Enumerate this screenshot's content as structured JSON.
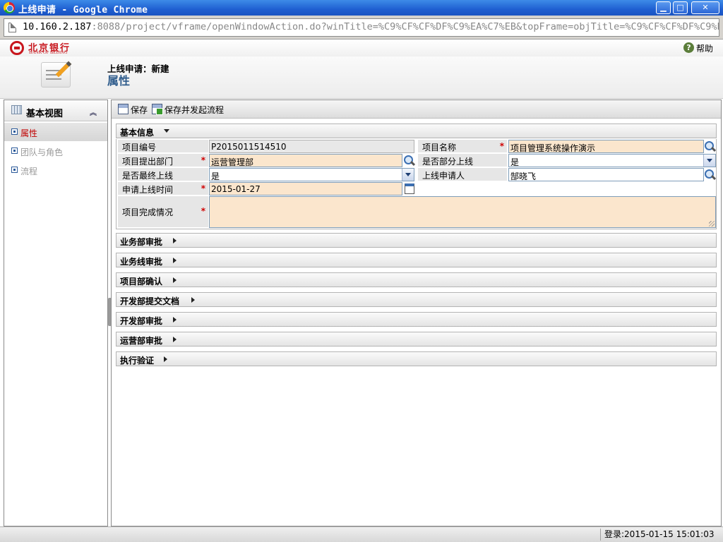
{
  "window": {
    "title": "上线申请 - Google Chrome",
    "minimize": "▁",
    "maximize": "□",
    "close": "✕"
  },
  "address_bar": {
    "host": "10.160.2.187",
    "rest": ":8088/project/vframe/openWindowAction.do?winTitle=%C9%CF%CF%DF%C9%EA%C7%EB&topFrame=objTitle=%C9%CF%CF%DF%C9%EA%C7"
  },
  "brand": {
    "name_cn": "北京银行",
    "name_en": "BANK OF BEIJING",
    "color": "#c8161d"
  },
  "help": {
    "icon": "?",
    "label": "帮助"
  },
  "header": {
    "subtitle": "上线申请：新建",
    "title": "属性"
  },
  "sidebar": {
    "title": "基本视图",
    "collapse": "︽",
    "items": [
      {
        "label": "属性",
        "state": "active"
      },
      {
        "label": "团队与角色",
        "state": "disabled"
      },
      {
        "label": "流程",
        "state": "disabled"
      }
    ]
  },
  "toolbar": {
    "save": "保存",
    "save_and_start": "保存并发起流程"
  },
  "basic_info": {
    "title": "基本信息",
    "fields": {
      "project_code": {
        "label": "项目编号",
        "value": "P2015011514510"
      },
      "project_name": {
        "label": "项目名称",
        "value": "项目管理系统操作演示"
      },
      "department": {
        "label": "项目提出部门",
        "value": "运营管理部"
      },
      "partial_online": {
        "label": "是否部分上线",
        "value": "是"
      },
      "final_online": {
        "label": "是否最终上线",
        "value": "是"
      },
      "applicant": {
        "label": "上线申请人",
        "value": "郜晓飞"
      },
      "apply_time": {
        "label": "申请上线时间",
        "value": "2015-01-27"
      },
      "completion": {
        "label": "项目完成情况",
        "value": ""
      }
    },
    "required_mark": "*"
  },
  "sections": [
    "业务部审批",
    "业务线审批",
    "项目部确认",
    "开发部提交文档",
    "开发部审批",
    "运营部审批",
    "执行验证"
  ],
  "status": {
    "login": "登录:2015-01-15 15:01:03"
  }
}
